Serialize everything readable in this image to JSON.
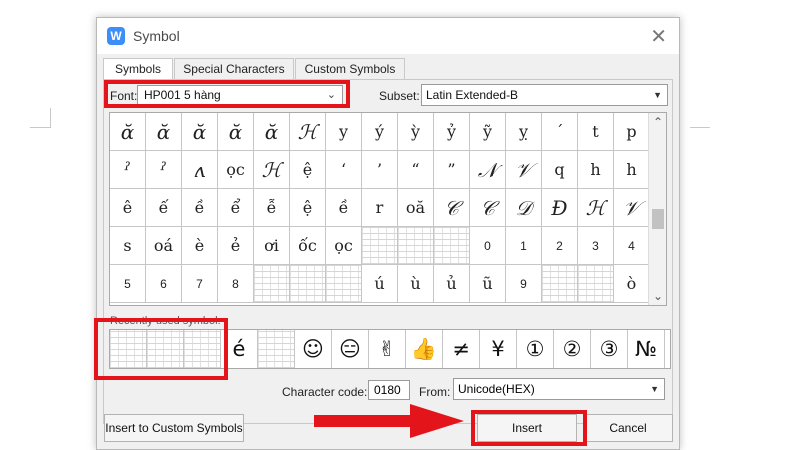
{
  "dialog": {
    "app_icon_letter": "W",
    "title": "Symbol",
    "close_glyph": "✕"
  },
  "tabs": [
    {
      "label": "Symbols",
      "active": true
    },
    {
      "label": "Special Characters",
      "active": false
    },
    {
      "label": "Custom Symbols",
      "active": false
    }
  ],
  "font": {
    "label": "Font:",
    "value": "HP001 5 hàng"
  },
  "subset": {
    "label": "Subset:",
    "value": "Latin Extended-B"
  },
  "grid": [
    [
      "ɑ̆",
      "ɑ̆",
      "ɑ̆",
      "ɑ̆",
      "ɑ̆",
      "ℋ",
      "y",
      "ý",
      "ỳ",
      "ỷ",
      "ỹ",
      "ỵ",
      "ˊ",
      "t",
      "p"
    ],
    [
      "ˀ",
      "ˀ",
      "ʌ",
      "ọc",
      "ℋ",
      "ệ",
      "‘",
      "’",
      "“",
      "”",
      "𝒩",
      "𝒱",
      "q",
      "h",
      "h"
    ],
    [
      "ê",
      "ế",
      "ề",
      "ể",
      "ễ",
      "ệ",
      "ề",
      "r",
      "oă",
      "𝒞",
      "𝒞",
      "𝒟",
      "Đ",
      "ℋ",
      "𝒱"
    ],
    [
      "s",
      "oá",
      "è",
      "ẻ",
      "ơi",
      "ốc",
      "ọc",
      "",
      "",
      "",
      "0",
      "1",
      "2",
      "3",
      "4"
    ],
    [
      "5",
      "6",
      "7",
      "8",
      "",
      "",
      "",
      "ú",
      "ù",
      "ủ",
      "ũ",
      "9",
      "",
      "",
      "ò"
    ]
  ],
  "recent": {
    "label": "Recently used symbol:",
    "symbols": [
      "",
      "",
      "",
      "é",
      "",
      "☺",
      "😑",
      "✌",
      "👍",
      "≠",
      "¥",
      "①",
      "②",
      "③",
      "№"
    ]
  },
  "character_code": {
    "label": "Character code:",
    "value": "0180"
  },
  "from": {
    "label": "From:",
    "value": "Unicode(HEX)"
  },
  "buttons": {
    "insert_custom": "Insert to Custom Symbols",
    "insert": "Insert",
    "cancel": "Cancel"
  },
  "colors": {
    "highlight": "#e3151a",
    "dialog_bg": "#f0f0f0"
  }
}
